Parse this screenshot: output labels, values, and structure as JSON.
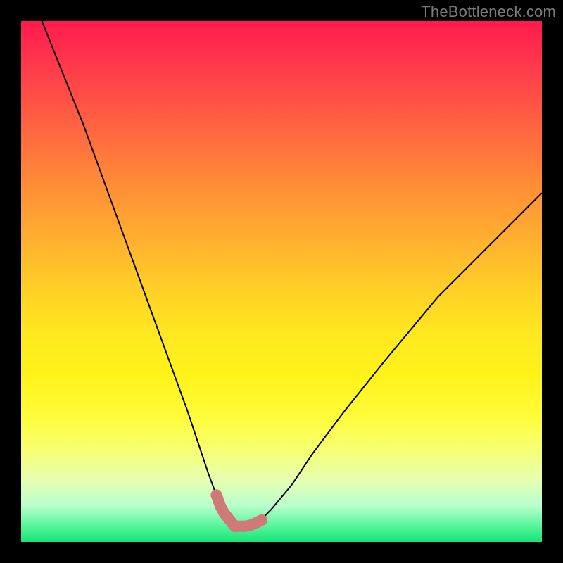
{
  "watermark": "TheBottleneck.com",
  "chart_data": {
    "type": "line",
    "title": "",
    "xlabel": "",
    "ylabel": "",
    "xlim": [
      0,
      100
    ],
    "ylim": [
      0,
      100
    ],
    "grid": false,
    "legend": false,
    "background": "rainbow-vertical-gradient",
    "series": [
      {
        "name": "bottleneck-curve",
        "color": "#000000",
        "stroke_width": 2,
        "x": [
          4,
          8,
          12,
          16,
          20,
          24,
          28,
          32,
          34,
          36,
          37.5,
          39,
          40,
          41,
          42,
          43,
          44,
          46,
          48,
          52,
          56,
          62,
          70,
          80,
          90,
          100
        ],
        "y": [
          100,
          90,
          80,
          69,
          58,
          47,
          36,
          25,
          19,
          13,
          9,
          5.5,
          3.6,
          3,
          3,
          3,
          3.2,
          4.2,
          6.2,
          11,
          17,
          25,
          35,
          47,
          57,
          67
        ]
      },
      {
        "name": "marker-cluster",
        "type": "scatter",
        "color": "#d17878",
        "marker_size": 16,
        "x": [
          37.5,
          38.3,
          39,
          41,
          43,
          44,
          45,
          46.2
        ],
        "y": [
          9,
          6.8,
          5.5,
          3,
          3,
          3.2,
          3.6,
          4.2
        ]
      }
    ],
    "annotations": []
  }
}
